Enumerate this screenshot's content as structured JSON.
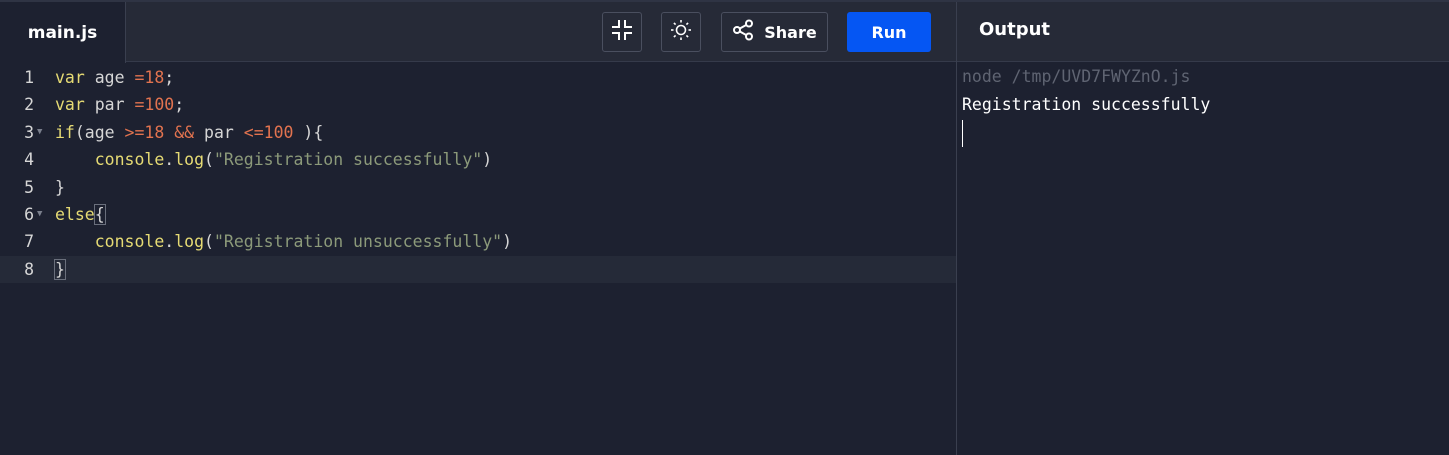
{
  "editor": {
    "tab_label": "main.js",
    "lines": [
      {
        "num": "1",
        "tokens": [
          [
            "kw",
            "var"
          ],
          [
            "pl",
            " age "
          ],
          [
            "op",
            "="
          ],
          [
            "num",
            "18"
          ],
          [
            "pl",
            ";"
          ]
        ]
      },
      {
        "num": "2",
        "tokens": [
          [
            "kw",
            "var"
          ],
          [
            "pl",
            " par "
          ],
          [
            "op",
            "="
          ],
          [
            "num",
            "100"
          ],
          [
            "pl",
            ";"
          ]
        ]
      },
      {
        "num": "3",
        "tokens": [
          [
            "kw",
            "if"
          ],
          [
            "pl",
            "(age "
          ],
          [
            "op",
            ">="
          ],
          [
            "num",
            "18"
          ],
          [
            "pl",
            " "
          ],
          [
            "op",
            "&&"
          ],
          [
            "pl",
            " par "
          ],
          [
            "op",
            "<="
          ],
          [
            "num",
            "100"
          ],
          [
            "pl",
            " ){"
          ]
        ]
      },
      {
        "num": "4",
        "tokens": [
          [
            "pl",
            "    "
          ],
          [
            "fn",
            "console"
          ],
          [
            "pl",
            "."
          ],
          [
            "fn",
            "log"
          ],
          [
            "pl",
            "("
          ],
          [
            "str",
            "\"Registration successfully\""
          ],
          [
            "pl",
            ")"
          ]
        ]
      },
      {
        "num": "5",
        "tokens": [
          [
            "pl",
            "}"
          ]
        ]
      },
      {
        "num": "6",
        "tokens": [
          [
            "kw",
            "else"
          ],
          [
            "pl",
            "{"
          ]
        ]
      },
      {
        "num": "7",
        "tokens": [
          [
            "pl",
            "    "
          ],
          [
            "fn",
            "console"
          ],
          [
            "pl",
            "."
          ],
          [
            "fn",
            "log"
          ],
          [
            "pl",
            "("
          ],
          [
            "str",
            "\"Registration unsuccessfully\""
          ],
          [
            "pl",
            ")"
          ]
        ]
      },
      {
        "num": "8",
        "tokens": [
          [
            "pl",
            "}"
          ]
        ]
      }
    ]
  },
  "toolbar": {
    "collapse_icon": "collapse-icon",
    "theme_icon": "sun-icon",
    "share_icon": "share-icon",
    "share_label": "Share",
    "run_label": "Run"
  },
  "output": {
    "title": "Output",
    "command": "node /tmp/UVD7FWYZnO.js",
    "result": "Registration successfully"
  },
  "colors": {
    "run_button": "#0556f3",
    "background": "#1d2130",
    "keyword": "#e6db74",
    "number": "#e2734f",
    "string": "#8c9a7a"
  }
}
